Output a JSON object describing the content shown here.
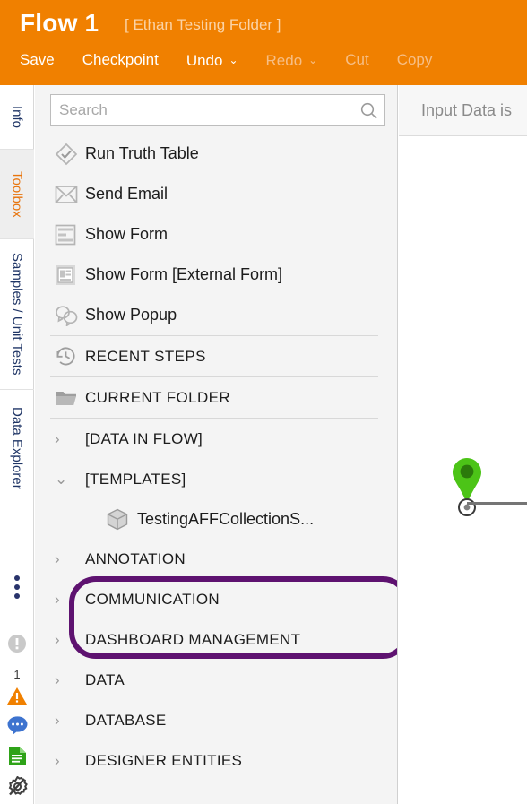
{
  "header": {
    "flow_title": "Flow 1",
    "folder_name": "[ Ethan Testing Folder ]",
    "toolbar": [
      {
        "label": "Save",
        "enabled": true,
        "caret": false
      },
      {
        "label": "Checkpoint",
        "enabled": true,
        "caret": false
      },
      {
        "label": "Undo",
        "enabled": true,
        "caret": true
      },
      {
        "label": "Redo",
        "enabled": false,
        "caret": true
      },
      {
        "label": "Cut",
        "enabled": false,
        "caret": false
      },
      {
        "label": "Copy",
        "enabled": false,
        "caret": false
      }
    ],
    "caret_glyph": "⌄",
    "accent_color": "#F08000"
  },
  "rail": {
    "tabs": [
      {
        "label": "Info",
        "active": false
      },
      {
        "label": "Toolbox",
        "active": true
      },
      {
        "label": "Samples / Unit Tests",
        "active": false
      },
      {
        "label": "Data Explorer",
        "active": false
      }
    ],
    "icons": [
      {
        "name": "overflow-menu-icon"
      },
      {
        "name": "info-circle-icon"
      },
      {
        "name": "warning-triangle-icon",
        "badge": "1"
      },
      {
        "name": "chat-bubble-icon"
      },
      {
        "name": "document-icon"
      },
      {
        "name": "gear-wrench-icon"
      }
    ],
    "active_color": "#E8740C",
    "label_color": "#1F3566"
  },
  "toolbox": {
    "search": {
      "placeholder": "Search",
      "value": ""
    },
    "steps": [
      {
        "label": "Run Truth Table",
        "icon": "diamond-check-icon"
      },
      {
        "label": "Send Email",
        "icon": "envelope-icon"
      },
      {
        "label": "Show Form",
        "icon": "form-icon"
      },
      {
        "label": "Show Form [External Form]",
        "icon": "external-form-icon"
      },
      {
        "label": "Show Popup",
        "icon": "popup-bubbles-icon"
      }
    ],
    "sections": [
      {
        "label": "RECENT STEPS",
        "icon": "history-clock-icon"
      },
      {
        "label": "CURRENT FOLDER",
        "icon": "folder-open-icon"
      }
    ],
    "categories": [
      {
        "label": "[DATA IN FLOW]",
        "expanded": false,
        "highlighted": false
      },
      {
        "label": "[TEMPLATES]",
        "expanded": true,
        "highlighted": true
      },
      {
        "label": "ANNOTATION",
        "expanded": false,
        "highlighted": false
      },
      {
        "label": "COMMUNICATION",
        "expanded": false,
        "highlighted": false
      },
      {
        "label": "DASHBOARD MANAGEMENT",
        "expanded": false,
        "highlighted": false
      },
      {
        "label": "DATA",
        "expanded": false,
        "highlighted": false
      },
      {
        "label": "DATABASE",
        "expanded": false,
        "highlighted": false
      },
      {
        "label": "DESIGNER ENTITIES",
        "expanded": false,
        "highlighted": false
      }
    ],
    "template_child": {
      "label": "TestingAFFCollectionS...",
      "icon": "cube-icon"
    },
    "chevron_collapsed": "›",
    "chevron_expanded": "⌄",
    "highlight_color": "#5E1270"
  },
  "canvas": {
    "header_title": "Input Data is",
    "start_marker": {
      "name": "start-pin-marker",
      "color": "#4CC417",
      "inner_color": "#2B7A0B"
    }
  }
}
